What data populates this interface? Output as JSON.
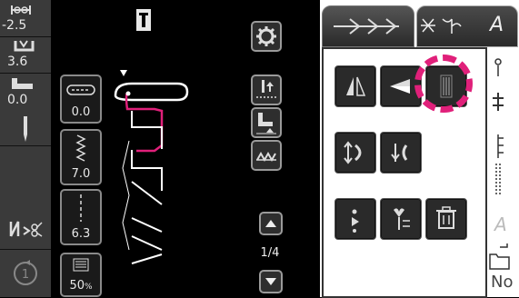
{
  "left_panel": {
    "stitch_width": "-2.5",
    "stitch_length": "3.6",
    "presser_height": "0.0"
  },
  "settings": {
    "box1": "0.0",
    "box2": "7.0",
    "box3": "6.3",
    "box4": "50",
    "box4_unit": "%"
  },
  "page_indicator": "1/4",
  "right_panel": {
    "tab_letter": "A",
    "bottom_label": "No"
  },
  "icons": [
    "width-icon",
    "length-icon",
    "presser-foot-icon",
    "needle-icon",
    "mirror-text-icon",
    "restart-icon",
    "settings-gear-icon",
    "scroll-up-icon",
    "scroll-down-icon",
    "delete-icon",
    "folder-icon"
  ]
}
